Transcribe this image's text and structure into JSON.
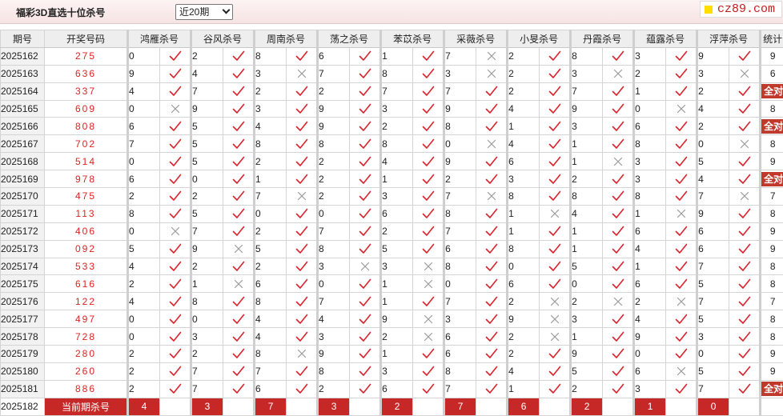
{
  "header": {
    "title": "福彩3D直选十位杀号",
    "period_select": "近20期",
    "site_logo": "cz89.com"
  },
  "table": {
    "col_issue": "期号",
    "col_draw": "开奖号码",
    "experts": [
      "鸿雁杀号",
      "谷风杀号",
      "周南杀号",
      "荡之杀号",
      "苯苡杀号",
      "采薇杀号",
      "小旻杀号",
      "丹霞杀号",
      "蕴露杀号",
      "浮萍杀号"
    ],
    "col_stat": "统计",
    "all_right_text": "全对",
    "rows": [
      {
        "issue": "2025162",
        "draw": "275",
        "kills": [
          0,
          2,
          8,
          6,
          1,
          7,
          2,
          8,
          3,
          9
        ],
        "marks": [
          1,
          1,
          1,
          1,
          1,
          0,
          1,
          1,
          1,
          1
        ],
        "stat": "9"
      },
      {
        "issue": "2025163",
        "draw": "636",
        "kills": [
          9,
          4,
          3,
          7,
          8,
          3,
          2,
          3,
          2,
          3
        ],
        "marks": [
          1,
          1,
          0,
          1,
          1,
          0,
          1,
          0,
          1,
          0
        ],
        "stat": "6"
      },
      {
        "issue": "2025164",
        "draw": "337",
        "kills": [
          4,
          7,
          2,
          2,
          7,
          7,
          2,
          7,
          1,
          2
        ],
        "marks": [
          1,
          1,
          1,
          1,
          1,
          1,
          1,
          1,
          1,
          1
        ],
        "stat": "全对"
      },
      {
        "issue": "2025165",
        "draw": "609",
        "kills": [
          0,
          9,
          3,
          9,
          3,
          9,
          4,
          9,
          0,
          4
        ],
        "marks": [
          0,
          1,
          1,
          1,
          1,
          1,
          1,
          1,
          0,
          1
        ],
        "stat": "8"
      },
      {
        "issue": "2025166",
        "draw": "808",
        "kills": [
          6,
          5,
          4,
          9,
          2,
          8,
          1,
          3,
          6,
          2
        ],
        "marks": [
          1,
          1,
          1,
          1,
          1,
          1,
          1,
          1,
          1,
          1
        ],
        "stat": "全对"
      },
      {
        "issue": "2025167",
        "draw": "702",
        "kills": [
          7,
          5,
          8,
          8,
          8,
          0,
          4,
          1,
          8,
          0
        ],
        "marks": [
          1,
          1,
          1,
          1,
          1,
          0,
          1,
          1,
          1,
          0
        ],
        "stat": "8"
      },
      {
        "issue": "2025168",
        "draw": "514",
        "kills": [
          0,
          5,
          2,
          2,
          4,
          9,
          6,
          1,
          3,
          5
        ],
        "marks": [
          1,
          1,
          1,
          1,
          1,
          1,
          1,
          0,
          1,
          1
        ],
        "stat": "9"
      },
      {
        "issue": "2025169",
        "draw": "978",
        "kills": [
          6,
          0,
          1,
          2,
          1,
          2,
          3,
          2,
          3,
          4
        ],
        "marks": [
          1,
          1,
          1,
          1,
          1,
          1,
          1,
          1,
          1,
          1
        ],
        "stat": "全对"
      },
      {
        "issue": "2025170",
        "draw": "475",
        "kills": [
          2,
          2,
          7,
          2,
          3,
          7,
          8,
          8,
          8,
          7
        ],
        "marks": [
          1,
          1,
          0,
          1,
          1,
          0,
          1,
          1,
          1,
          0
        ],
        "stat": "7"
      },
      {
        "issue": "2025171",
        "draw": "113",
        "kills": [
          8,
          5,
          0,
          0,
          6,
          8,
          1,
          4,
          1,
          9
        ],
        "marks": [
          1,
          1,
          1,
          1,
          1,
          1,
          0,
          1,
          0,
          1
        ],
        "stat": "8"
      },
      {
        "issue": "2025172",
        "draw": "406",
        "kills": [
          0,
          7,
          2,
          7,
          2,
          7,
          1,
          1,
          6,
          6
        ],
        "marks": [
          0,
          1,
          1,
          1,
          1,
          1,
          1,
          1,
          1,
          1
        ],
        "stat": "9"
      },
      {
        "issue": "2025173",
        "draw": "092",
        "kills": [
          5,
          9,
          5,
          8,
          5,
          6,
          8,
          1,
          4,
          6
        ],
        "marks": [
          1,
          0,
          1,
          1,
          1,
          1,
          1,
          1,
          1,
          1
        ],
        "stat": "9"
      },
      {
        "issue": "2025174",
        "draw": "533",
        "kills": [
          4,
          2,
          2,
          3,
          3,
          8,
          0,
          5,
          1,
          7
        ],
        "marks": [
          1,
          1,
          1,
          0,
          0,
          1,
          1,
          1,
          1,
          1
        ],
        "stat": "8"
      },
      {
        "issue": "2025175",
        "draw": "616",
        "kills": [
          2,
          1,
          6,
          0,
          1,
          0,
          6,
          0,
          6,
          5
        ],
        "marks": [
          1,
          0,
          1,
          1,
          0,
          1,
          1,
          1,
          1,
          1
        ],
        "stat": "8"
      },
      {
        "issue": "2025176",
        "draw": "122",
        "kills": [
          4,
          8,
          8,
          7,
          1,
          7,
          2,
          2,
          2,
          7
        ],
        "marks": [
          1,
          1,
          1,
          1,
          1,
          1,
          0,
          0,
          0,
          1
        ],
        "stat": "7"
      },
      {
        "issue": "2025177",
        "draw": "497",
        "kills": [
          0,
          0,
          4,
          4,
          9,
          3,
          9,
          3,
          4,
          5
        ],
        "marks": [
          1,
          1,
          1,
          1,
          0,
          1,
          0,
          1,
          1,
          1
        ],
        "stat": "8"
      },
      {
        "issue": "2025178",
        "draw": "728",
        "kills": [
          0,
          3,
          4,
          3,
          2,
          6,
          2,
          1,
          9,
          3
        ],
        "marks": [
          1,
          1,
          1,
          1,
          0,
          1,
          0,
          1,
          1,
          1
        ],
        "stat": "8"
      },
      {
        "issue": "2025179",
        "draw": "280",
        "kills": [
          2,
          2,
          8,
          9,
          1,
          6,
          2,
          9,
          0,
          0
        ],
        "marks": [
          1,
          1,
          0,
          1,
          1,
          1,
          1,
          1,
          1,
          1
        ],
        "stat": "9"
      },
      {
        "issue": "2025180",
        "draw": "260",
        "kills": [
          2,
          7,
          7,
          8,
          3,
          8,
          4,
          5,
          6,
          5
        ],
        "marks": [
          1,
          1,
          1,
          1,
          1,
          1,
          1,
          1,
          0,
          1
        ],
        "stat": "9"
      },
      {
        "issue": "2025181",
        "draw": "886",
        "kills": [
          2,
          7,
          6,
          2,
          6,
          7,
          1,
          2,
          3,
          7
        ],
        "marks": [
          1,
          1,
          1,
          1,
          1,
          1,
          1,
          1,
          1,
          1
        ],
        "stat": "全对"
      }
    ],
    "current": {
      "issue": "2025182",
      "label": "当前期杀号",
      "kills": [
        4,
        3,
        7,
        3,
        2,
        7,
        6,
        2,
        1,
        0
      ]
    }
  },
  "colors": {
    "check": "#d9232d",
    "cross": "#9a9a9a",
    "highlight_red": "#c62828",
    "draw_red": "#dd2222"
  }
}
